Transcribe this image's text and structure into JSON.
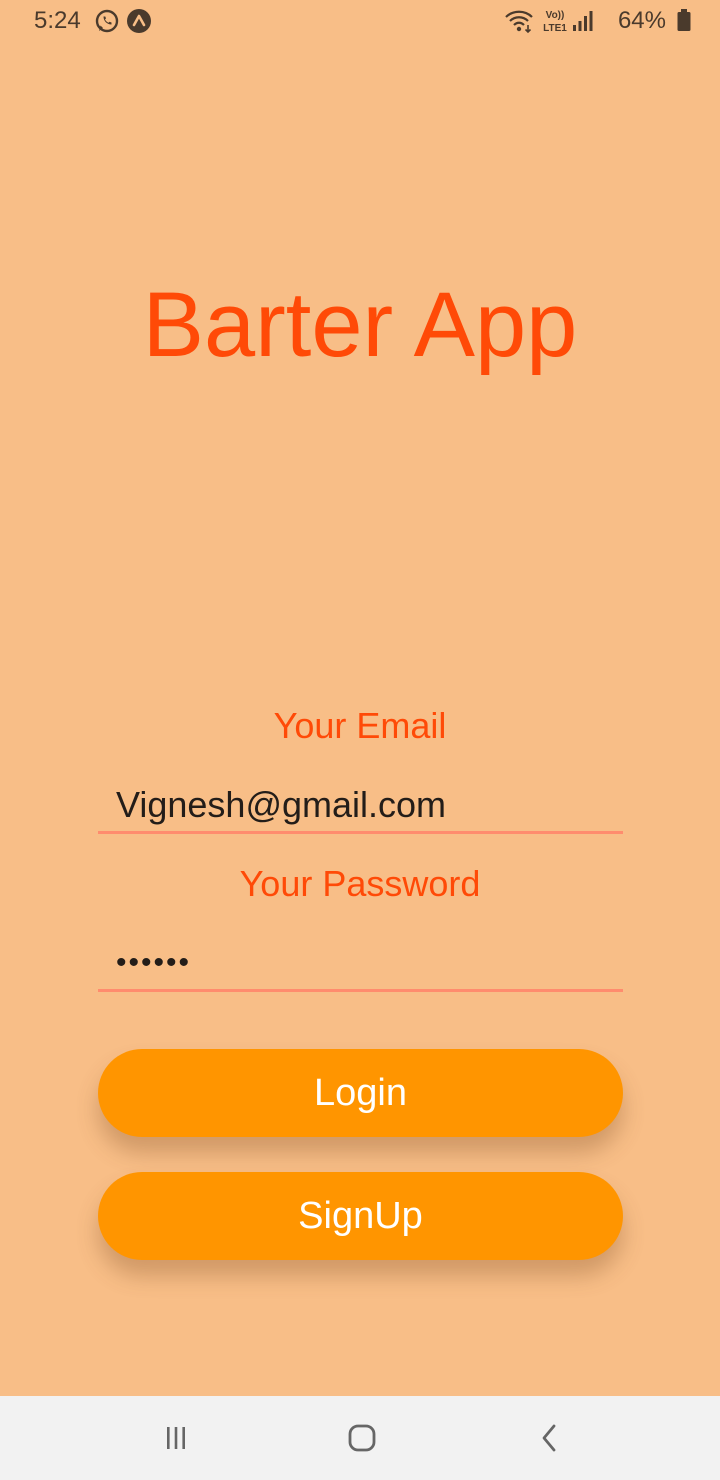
{
  "status_bar": {
    "time": "5:24",
    "battery": "64%",
    "icons": [
      "whatsapp-icon",
      "expo-icon",
      "wifi-icon",
      "volte-lte-icon",
      "signal-icon",
      "battery-icon"
    ],
    "volte_label": "Vo)) LTE1"
  },
  "app": {
    "title": "Barter App"
  },
  "form": {
    "email_label": "Your Email",
    "email_value": "Vignesh@gmail.com",
    "password_label": "Your Password",
    "password_value": "••••••",
    "login_label": "Login",
    "signup_label": "SignUp"
  },
  "nav_bar": {
    "icons": [
      "recent-apps-icon",
      "home-icon",
      "back-icon"
    ]
  },
  "colors": {
    "background": "#f8be87",
    "title": "#ff4a07",
    "button": "#ff9500",
    "underline": "#ff8c6e",
    "nav_background": "#f2f2f2"
  }
}
